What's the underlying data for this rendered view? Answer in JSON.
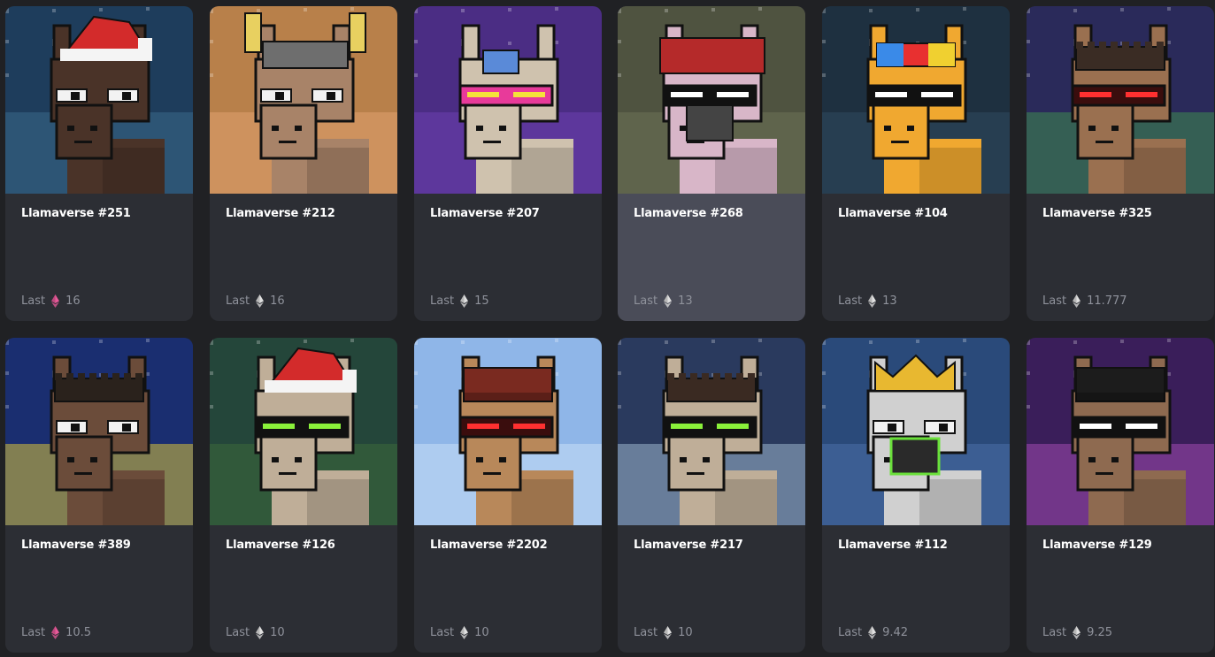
{
  "price_label": "Last",
  "items": [
    {
      "title": "Llamaverse #251",
      "price": "16",
      "eth_color": "#e85a9a",
      "bg": "#1e3d5c",
      "bg2": "#3a6a8a",
      "fur": "#4a3328",
      "accent": "#d32b2b",
      "acc_type": "santa",
      "eyes": "plain",
      "hover": false
    },
    {
      "title": "Llamaverse #212",
      "price": "16",
      "eth_color": "#e0e0e0",
      "bg": "#b8804a",
      "bg2": "#e0a070",
      "fur": "#a88368",
      "accent": "#6e6e6e",
      "acc_type": "horns",
      "eyes": "plain",
      "hover": false
    },
    {
      "title": "Llamaverse #207",
      "price": "15",
      "eth_color": "#e0e0e0",
      "bg": "#4b2d84",
      "bg2": "#6e3fb0",
      "fur": "#cfc2ae",
      "accent": "#1f1f1f",
      "acc_type": "rainbow",
      "eyes": "rainbow",
      "hover": false
    },
    {
      "title": "Llamaverse #268",
      "price": "13",
      "eth_color": "#e0e0e0",
      "bg": "#4f5340",
      "bg2": "#6e7255",
      "fur": "#d8b6c8",
      "accent": "#b52a2a",
      "acc_type": "hood",
      "eyes": "shades",
      "hover": true
    },
    {
      "title": "Llamaverse #104",
      "price": "13",
      "eth_color": "#e0e0e0",
      "bg": "#1e3040",
      "bg2": "#2f4a5e",
      "fur": "#f0a830",
      "accent": "#e83030",
      "acc_type": "propeller",
      "eyes": "shades",
      "hover": false
    },
    {
      "title": "Llamaverse #325",
      "price": "11.777",
      "eth_color": "#e0e0e0",
      "bg": "#2a2a5a",
      "bg2": "#3e8a50",
      "fur": "#9a7050",
      "accent": "#3a2c24",
      "acc_type": "hair",
      "eyes": "visor-red",
      "hover": false
    },
    {
      "title": "Llamaverse #389",
      "price": "10.5",
      "eth_color": "#e85a9a",
      "bg": "#1a2e70",
      "bg2": "#d9c23a",
      "fur": "#6b4c3a",
      "accent": "#2a221c",
      "acc_type": "hair",
      "eyes": "plain",
      "hover": false
    },
    {
      "title": "Llamaverse #126",
      "price": "10",
      "eth_color": "#e0e0e0",
      "bg": "#24463a",
      "bg2": "#3d6a3a",
      "fur": "#bfae98",
      "accent": "#d32b2b",
      "acc_type": "santa",
      "eyes": "visor-green",
      "hover": false
    },
    {
      "title": "Llamaverse #2202",
      "price": "10",
      "eth_color": "#e0e0e0",
      "bg": "#8fb6e8",
      "bg2": "#c9dff5",
      "fur": "#b8885a",
      "accent": "#7a2a20",
      "acc_type": "beanie",
      "eyes": "visor-red",
      "hover": false
    },
    {
      "title": "Llamaverse #217",
      "price": "10",
      "eth_color": "#e0e0e0",
      "bg": "#2a3a5e",
      "bg2": "#9ab4cc",
      "fur": "#bfae98",
      "accent": "#3a2a22",
      "acc_type": "hair",
      "eyes": "visor-green",
      "hover": false
    },
    {
      "title": "Llamaverse #112",
      "price": "9.42",
      "eth_color": "#e0e0e0",
      "bg": "#2a4a7a",
      "bg2": "#4a70a8",
      "fur": "#d0d0d0",
      "accent": "#e8b830",
      "acc_type": "crown",
      "eyes": "plain",
      "hover": false
    },
    {
      "title": "Llamaverse #129",
      "price": "9.25",
      "eth_color": "#e0e0e0",
      "bg": "#3a1e5a",
      "bg2": "#a04ab0",
      "fur": "#8e6a50",
      "accent": "#1c1c1c",
      "acc_type": "beanie",
      "eyes": "shades",
      "hover": false
    }
  ]
}
